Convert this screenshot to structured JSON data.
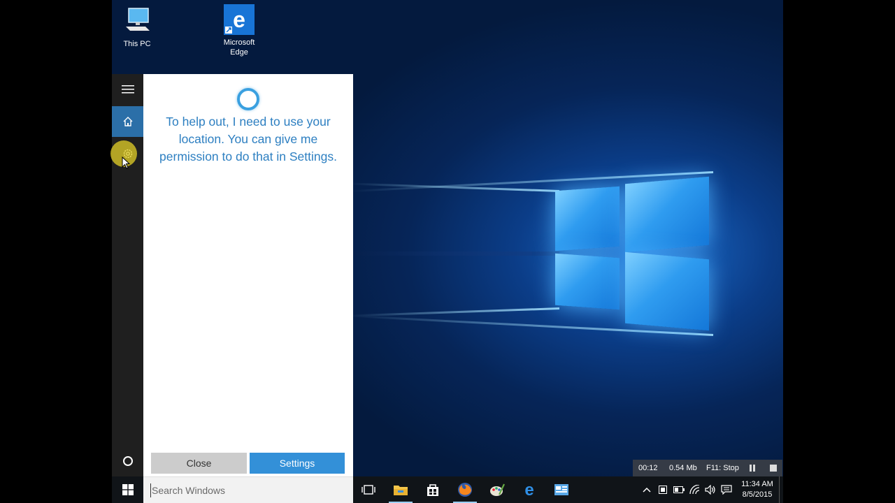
{
  "desktop": {
    "icons": [
      {
        "label": "This PC",
        "icon": "computer-icon"
      },
      {
        "label": "Microsoft Edge",
        "icon": "edge-icon"
      }
    ],
    "icon_label_lines": {
      "edge_1": "Microsoft",
      "edge_2": "Edge"
    }
  },
  "cortana": {
    "rail": {
      "menu_icon": "hamburger-icon",
      "home_icon": "home-icon",
      "settings_icon": "gear-icon",
      "cortana_icon": "circle-icon"
    },
    "message": "To help out, I need to use your location. You can give me permission to do that in Settings.",
    "close_label": "Close",
    "settings_label": "Settings",
    "accent_color": "#3390d8"
  },
  "taskbar": {
    "search_placeholder": "Search Windows",
    "apps": [
      {
        "name": "task-view-icon"
      },
      {
        "name": "file-explorer-icon"
      },
      {
        "name": "store-icon"
      },
      {
        "name": "firefox-icon"
      },
      {
        "name": "paint-icon"
      },
      {
        "name": "edge-icon"
      },
      {
        "name": "network-app-icon"
      }
    ],
    "tray": {
      "time": "11:34 AM",
      "date": "8/5/2015"
    }
  },
  "recorder": {
    "elapsed": "00:12",
    "size": "0.54 Mb",
    "stop_hint": "F11: Stop"
  }
}
